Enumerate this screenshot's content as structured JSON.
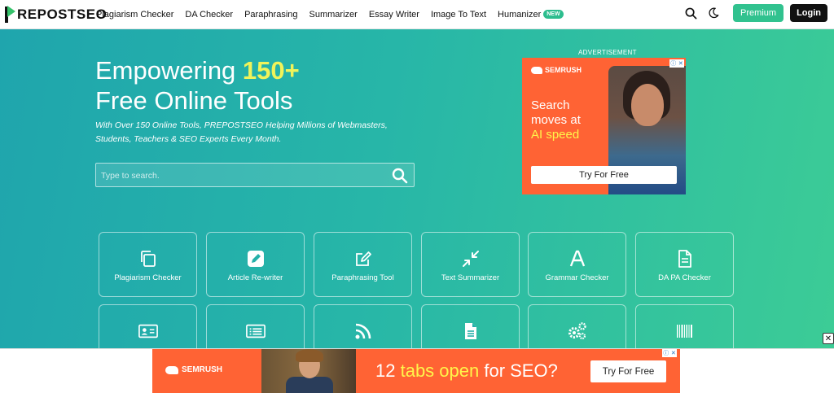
{
  "brand": {
    "logo_text": "REPOSTSEO"
  },
  "nav": {
    "items": [
      {
        "label": "Plagiarism Checker"
      },
      {
        "label": "DA Checker"
      },
      {
        "label": "Paraphrasing"
      },
      {
        "label": "Summarizer"
      },
      {
        "label": "Essay Writer"
      },
      {
        "label": "Image To Text"
      },
      {
        "label": "Humanizer",
        "badge": "NEW"
      }
    ],
    "premium_label": "Premium",
    "login_label": "Login",
    "icons": [
      "search-icon",
      "moon-icon"
    ]
  },
  "hero": {
    "title_prefix": "Empowering ",
    "title_highlight": "150+",
    "title_line2": "Free Online Tools",
    "subtitle": "With Over 150 Online Tools, PREPOSTSEO Helping Millions of Webmasters, Students, Teachers & SEO Experts Every Month.",
    "search_placeholder": "Type to search."
  },
  "ad_top": {
    "label": "ADVERTISEMENT",
    "brand": "SEMRUSH",
    "headline_1": "Search",
    "headline_2": "moves at",
    "headline_ai": "AI speed",
    "cta": "Try For Free"
  },
  "tools": [
    {
      "label": "Plagiarism Checker",
      "icon": "copy-icon"
    },
    {
      "label": "Article Re-writer",
      "icon": "edit-icon"
    },
    {
      "label": "Paraphrasing Tool",
      "icon": "pen-square-icon"
    },
    {
      "label": "Text Summarizer",
      "icon": "compress-icon"
    },
    {
      "label": "Grammar Checker",
      "icon": "letter-a-icon"
    },
    {
      "label": "DA PA Checker",
      "icon": "document-icon"
    },
    {
      "label": "",
      "icon": "id-card-icon"
    },
    {
      "label": "",
      "icon": "list-icon"
    },
    {
      "label": "",
      "icon": "rss-icon"
    },
    {
      "label": "",
      "icon": "file-text-icon"
    },
    {
      "label": "",
      "icon": "gears-icon"
    },
    {
      "label": "",
      "icon": "barcode-icon"
    }
  ],
  "ad_bottom": {
    "brand": "SEMRUSH",
    "headline_1": "12 ",
    "headline_hl": "tabs open",
    "headline_2": " for SEO?",
    "cta": "Try For Free",
    "close": "✕"
  },
  "colors": {
    "hero_start": "#1fa5ad",
    "hero_end": "#3ccc96",
    "highlight": "#f0f35a",
    "premium": "#31c28f",
    "ad_orange": "#ff6334"
  }
}
